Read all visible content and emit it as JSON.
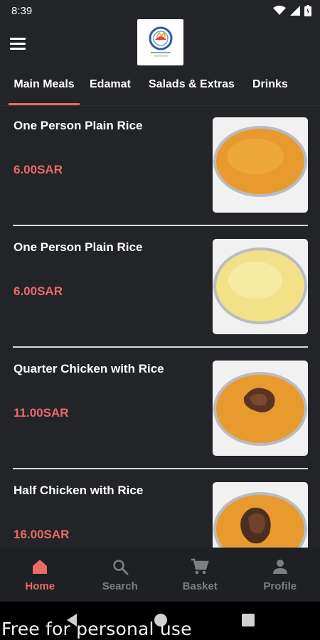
{
  "status_bar": {
    "time": "8:39"
  },
  "tabs": [
    {
      "label": "Main Meals",
      "active": true
    },
    {
      "label": "Edamat",
      "active": false
    },
    {
      "label": "Salads & Extras",
      "active": false
    },
    {
      "label": "Drinks",
      "active": false
    }
  ],
  "items": [
    {
      "name": "One Person Plain Rice",
      "price": "6.00SAR",
      "image": "orange-rice-plate"
    },
    {
      "name": "One Person Plain Rice",
      "price": "6.00SAR",
      "image": "white-rice-plate"
    },
    {
      "name": "Quarter Chicken with Rice",
      "price": "11.00SAR",
      "image": "chicken-rice-plate"
    },
    {
      "name": "Half Chicken with Rice",
      "price": "16.00SAR",
      "image": "chicken-rice-plate"
    }
  ],
  "bottom_nav": [
    {
      "label": "Home",
      "icon": "home-icon",
      "active": true
    },
    {
      "label": "Search",
      "icon": "search-icon",
      "active": false
    },
    {
      "label": "Basket",
      "icon": "cart-icon",
      "active": false
    },
    {
      "label": "Profile",
      "icon": "profile-icon",
      "active": false
    }
  ],
  "watermark": "Free for personal use",
  "colors": {
    "accent": "#e96a6a",
    "background": "#232427",
    "nav_inactive": "#7d7e82"
  }
}
